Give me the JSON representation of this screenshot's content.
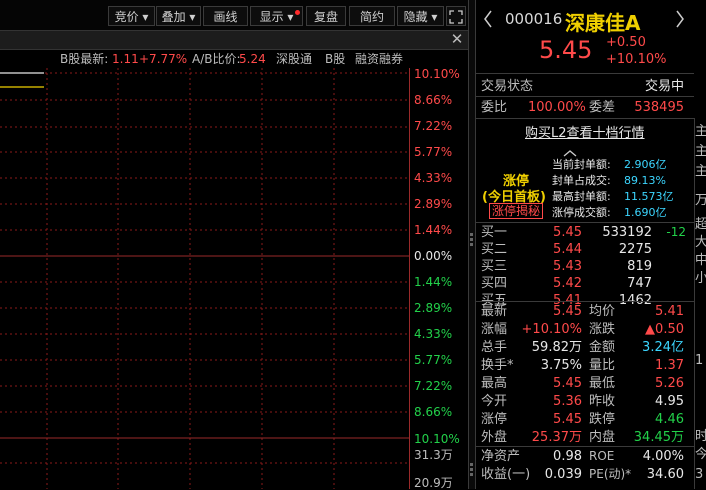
{
  "toolbar": {
    "buttons": [
      "竞价",
      "叠加",
      "画线",
      "显示",
      "复盘",
      "简约",
      "隐藏"
    ],
    "dropdown_arrow": "▾"
  },
  "info_bar": {
    "b_latest_label": "B股最新:",
    "b_latest_value": "1.11",
    "b_latest_change": "+7.77%",
    "ab_ratio_label": "A/B比价:",
    "ab_ratio_value": "5.24",
    "tags": [
      "深股通",
      "B股",
      "融资融券"
    ]
  },
  "chart_data": {
    "type": "line",
    "y_pct_labels_up": [
      "10.10%",
      "8.66%",
      "7.22%",
      "5.77%",
      "4.33%",
      "2.89%",
      "1.44%"
    ],
    "zero_label": "0.00%",
    "y_pct_labels_down": [
      "1.44%",
      "2.89%",
      "4.33%",
      "5.77%",
      "7.22%",
      "8.66%",
      "10.10%"
    ],
    "volume_labels": [
      "31.3万",
      "20.9万"
    ]
  },
  "stock": {
    "code": "000016",
    "name": "深康佳A",
    "price": "5.45",
    "change": "+0.50",
    "change_pct": "+10.10%"
  },
  "status": {
    "label": "交易状态",
    "value": "交易中"
  },
  "ratio": {
    "wei_bi_label": "委比",
    "wei_bi_value": "100.00%",
    "wei_cha_label": "委差",
    "wei_cha_value": "538495"
  },
  "l2_link": "购买L2查看十档行情",
  "limit_up": {
    "title": "涨停",
    "subtitle": "(今日首板)",
    "reveal_btn": "涨停揭秘",
    "stats": [
      {
        "label": "当前封单额:",
        "value": "2.906亿"
      },
      {
        "label": "封单占成交:",
        "value": "89.13%"
      },
      {
        "label": "最高封单额:",
        "value": "11.573亿"
      },
      {
        "label": "涨停成交额:",
        "value": "1.690亿"
      }
    ]
  },
  "order_book": [
    {
      "label": "买一",
      "price": "5.45",
      "vol": "533192",
      "delta": "-12"
    },
    {
      "label": "买二",
      "price": "5.44",
      "vol": "2275",
      "delta": ""
    },
    {
      "label": "买三",
      "price": "5.43",
      "vol": "819",
      "delta": ""
    },
    {
      "label": "买四",
      "price": "5.42",
      "vol": "747",
      "delta": ""
    },
    {
      "label": "买五",
      "price": "5.41",
      "vol": "1462",
      "delta": ""
    }
  ],
  "quote": [
    {
      "l1": "最新",
      "v1": "5.45",
      "c1": "red",
      "l2": "均价",
      "v2": "5.41",
      "c2": "red"
    },
    {
      "l1": "涨幅",
      "v1": "+10.10%",
      "c1": "red",
      "l2": "涨跌",
      "v2": "▲0.50",
      "c2": "red"
    },
    {
      "l1": "总手",
      "v1": "59.82万",
      "c1": "white",
      "l2": "金额",
      "v2": "3.24亿",
      "c2": "cyan"
    },
    {
      "l1": "换手*",
      "v1": "3.75%",
      "c1": "white",
      "l2": "量比",
      "v2": "1.37",
      "c2": "red"
    },
    {
      "l1": "最高",
      "v1": "5.45",
      "c1": "red",
      "l2": "最低",
      "v2": "5.26",
      "c2": "red"
    },
    {
      "l1": "今开",
      "v1": "5.36",
      "c1": "red",
      "l2": "昨收",
      "v2": "4.95",
      "c2": "white"
    },
    {
      "l1": "涨停",
      "v1": "5.45",
      "c1": "red",
      "l2": "跌停",
      "v2": "4.46",
      "c2": "green"
    },
    {
      "l1": "外盘",
      "v1": "25.37万",
      "c1": "red",
      "l2": "内盘",
      "v2": "34.45万",
      "c2": "green"
    },
    {
      "l1": "净资产",
      "v1": "0.98",
      "c1": "white",
      "l2": "ROE",
      "v2": "4.00%",
      "c2": "white"
    },
    {
      "l1": "收益(一)",
      "v1": "0.039",
      "c1": "white",
      "l2": "PE(动)*",
      "v2": "34.60",
      "c2": "white"
    }
  ],
  "edge_labels": [
    "主",
    "主",
    "主",
    "万",
    "超",
    "大",
    "中",
    "小",
    "1",
    "时",
    "今",
    "3"
  ]
}
